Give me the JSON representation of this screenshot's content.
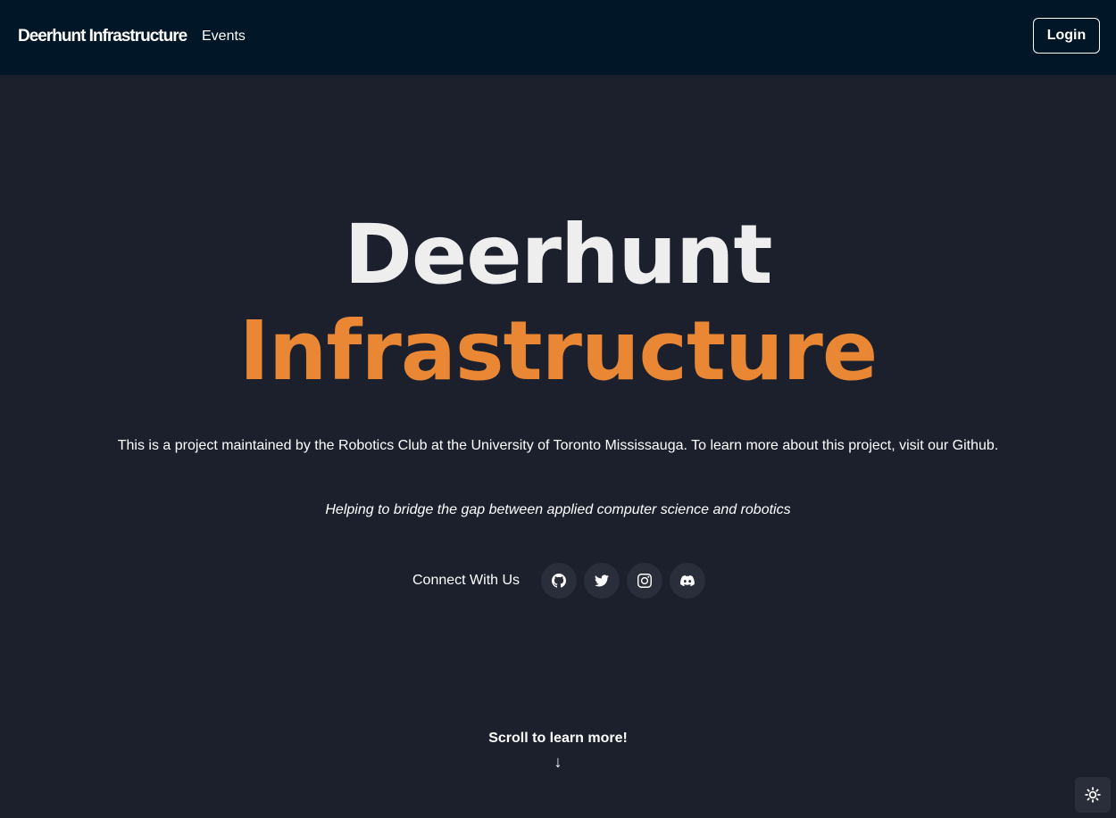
{
  "navbar": {
    "brand": "Deerhunt Infrastructure",
    "links": [
      "Events"
    ],
    "login_label": "Login"
  },
  "hero": {
    "title_line1": "Deerhunt",
    "title_line2": "Infrastructure",
    "description": "This is a project maintained by the Robotics Club at the University of Toronto Mississauga. To learn more about this project, visit our Github.",
    "tagline": "Helping to bridge the gap between applied computer science and robotics"
  },
  "connect": {
    "label": "Connect With Us",
    "socials": [
      "github-icon",
      "twitter-icon",
      "instagram-icon",
      "discord-icon"
    ]
  },
  "scroll": {
    "text": "Scroll to learn more!",
    "arrow": "↓"
  },
  "theme_toggle": {
    "icon": "sun-icon"
  },
  "colors": {
    "navbar_bg": "#011627",
    "page_bg": "#1c202d",
    "accent": "#e98734",
    "title_light": "#eeeeee",
    "button_bg": "#2a2e3a"
  }
}
